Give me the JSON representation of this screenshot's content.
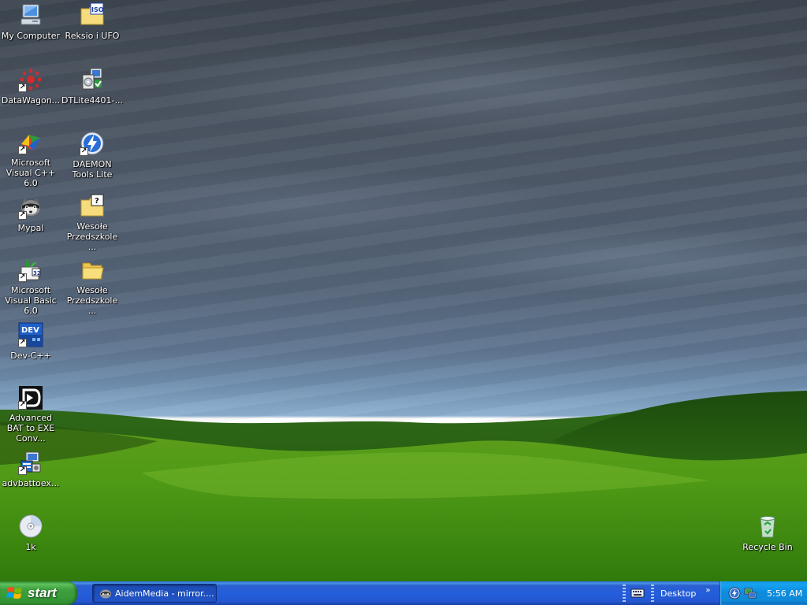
{
  "desktop": {
    "icons": [
      {
        "label": "My Computer"
      },
      {
        "label": "Reksio i UFO"
      },
      {
        "label": "DataWagon..."
      },
      {
        "label": "DTLite4401-..."
      },
      {
        "label": "Microsoft Visual C++ 6.0"
      },
      {
        "label": "DAEMON Tools Lite"
      },
      {
        "label": "Mypal"
      },
      {
        "label": "Wesołe Przedszkole ..."
      },
      {
        "label": "Microsoft Visual Basic 6.0"
      },
      {
        "label": "Wesołe Przedszkole ..."
      },
      {
        "label": "Dev-C++"
      },
      {
        "label": "Advanced BAT to EXE Conv..."
      },
      {
        "label": "advbattoex..."
      },
      {
        "label": "1k"
      },
      {
        "label": "Recycle Bin"
      }
    ],
    "iso_badge": "ISO",
    "help_badge": "?",
    "dev_badge": "DEV",
    "vb_badge": "32"
  },
  "taskbar": {
    "start_label": "start",
    "task_button_label": "AidemMedia - mirror....",
    "toolbar_label": "Desktop",
    "chevron": "»",
    "clock": "5:56 AM"
  },
  "icons": {
    "shortcut_arrow": "↗"
  },
  "colors": {
    "taskbar_blue": "#245edb",
    "start_green": "#3d9f3d",
    "tray_blue": "#0f89d8"
  }
}
